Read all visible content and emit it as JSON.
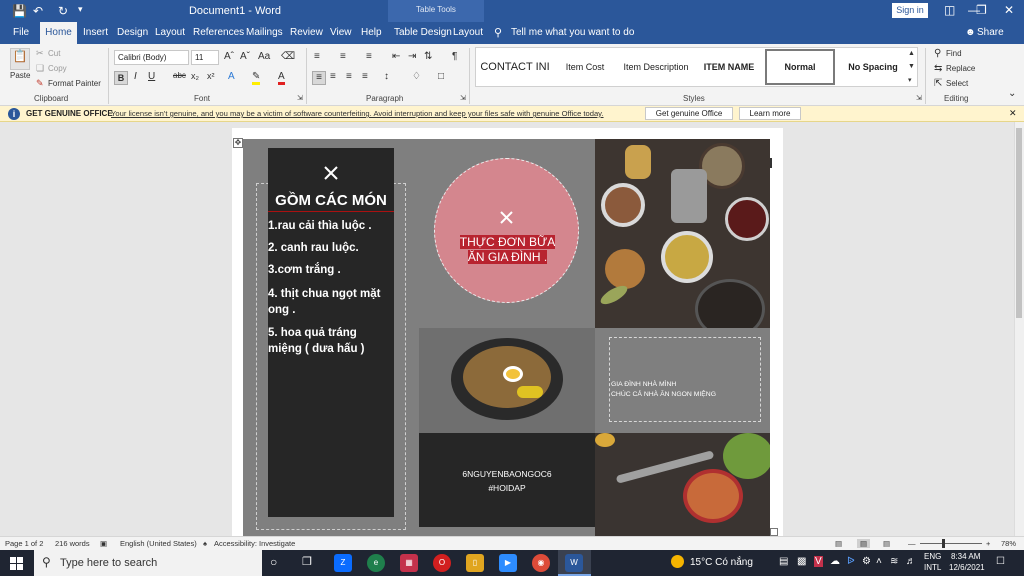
{
  "window": {
    "title": "Document1 - Word",
    "contextual_tab": "Table Tools",
    "sign_in": "Sign in"
  },
  "tabs": [
    "File",
    "Home",
    "Insert",
    "Design",
    "Layout",
    "References",
    "Mailings",
    "Review",
    "View",
    "Help",
    "Table Design",
    "Layout"
  ],
  "tell_me": "Tell me what you want to do",
  "share": "Share",
  "ribbon": {
    "clipboard": {
      "paste": "Paste",
      "cut": "Cut",
      "copy": "Copy",
      "format_painter": "Format Painter",
      "label": "Clipboard"
    },
    "font": {
      "name": "Calibri (Body)",
      "size": "11",
      "label": "Font"
    },
    "paragraph": {
      "label": "Paragraph"
    },
    "styles": {
      "items": [
        "CONTACT INI",
        "Item Cost",
        "Item Description",
        "ITEM NAME",
        "Normal",
        "No Spacing"
      ],
      "label": "Styles"
    },
    "editing": {
      "find": "Find",
      "replace": "Replace",
      "select": "Select",
      "label": "Editing"
    }
  },
  "infobar": {
    "title": "GET GENUINE OFFICE",
    "message": "Your license isn't genuine, and you may be a victim of software counterfeiting. Avoid interruption and keep your files safe with genuine Office today.",
    "get_genuine": "Get genuine Office",
    "learn_more": "Learn more"
  },
  "document": {
    "menu_heading": "GỒM CÁC MÓN",
    "menu_items": [
      "1.rau cải thìa luộc .",
      "2. canh rau luộc.",
      "3.cơm trắng .",
      "4. thịt chua ngọt mặt ong .",
      "5. hoa quả tráng miệng ( dưa hấu )"
    ],
    "circle_title": "THỰC ĐƠN BỮA ĂN GIA ĐÌNH .",
    "greeting_line1": "GIA ĐÌNH NHÀ MÌNH",
    "greeting_line2": "CHÚC CẢ NHÀ ĂN NGON MIỆNG",
    "credit_line1": "6NGUYENBAONGOC6",
    "credit_line2": "#HOIDAP"
  },
  "status": {
    "page": "Page 1 of 2",
    "words": "216 words",
    "language": "English (United States)",
    "accessibility": "Accessibility: Investigate",
    "zoom": "78%"
  },
  "taskbar": {
    "search_placeholder": "Type here to search",
    "weather": "15°C Có nắng",
    "lang_line1": "ENG",
    "lang_line2": "INTL",
    "time": "8:34 AM",
    "date": "12/6/2021"
  },
  "colors": {
    "word_blue": "#2b579a",
    "menu_panel": "#262626",
    "circle_fill": "#d4868e",
    "circle_text_bg": "#b8232f",
    "page_overlay": "#7f7f7f"
  }
}
